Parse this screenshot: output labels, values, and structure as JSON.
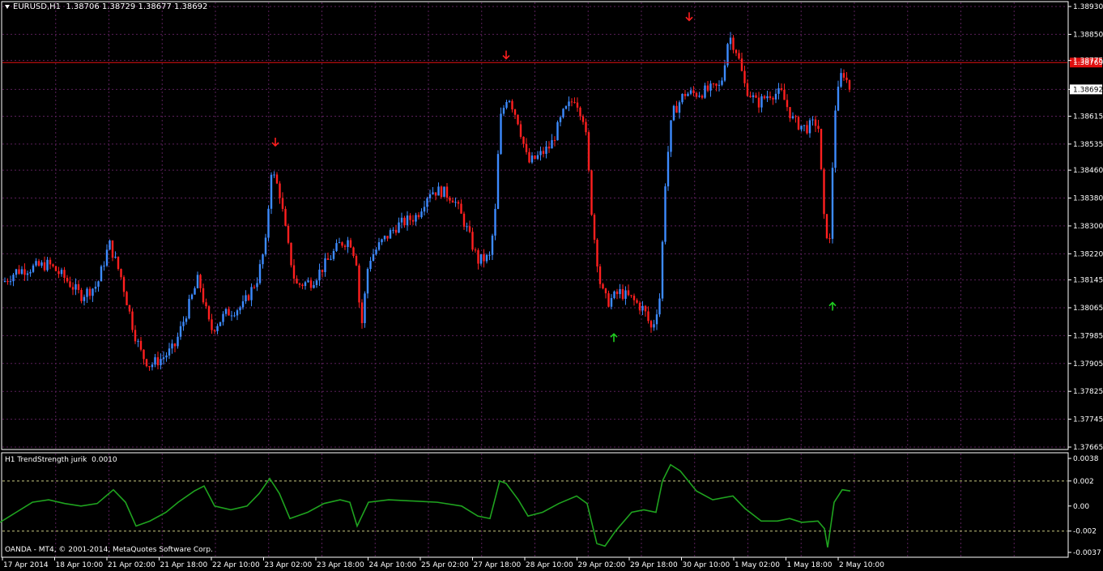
{
  "header": {
    "symbol": "EURUSD,H1",
    "open": "1.38706",
    "high": "1.38729",
    "low": "1.38677",
    "close": "1.38692"
  },
  "indicator": {
    "title": "H1 TrendStrength jurik",
    "value": "0.0010"
  },
  "copyright": "OANDA - MT4, © 2001-2014, MetaQuotes Software Corp.",
  "colors": {
    "background": "#000000",
    "bull": "#3d8bff",
    "bear": "#ff1f1f",
    "indicator": "#1fa31f",
    "grid": "#5a1f5a",
    "arrow_up": "#1fce1f",
    "arrow_down": "#ff1f1f"
  },
  "chart_data": {
    "type": "candlestick",
    "price_axis": [
      "1.38930",
      "1.38850",
      "1.38775",
      "1.38692",
      "1.38615",
      "1.38535",
      "1.38460",
      "1.38380",
      "1.38300",
      "1.38220",
      "1.38145",
      "1.38065",
      "1.37985",
      "1.37905",
      "1.37825",
      "1.37745",
      "1.37665"
    ],
    "ylim": [
      1.37665,
      1.3893
    ],
    "current_price": "1.38692",
    "bid_line_price": "1.38769",
    "time_axis": [
      "17 Apr 2014",
      "18 Apr 10:00",
      "21 Apr 02:00",
      "21 Apr 18:00",
      "22 Apr 10:00",
      "23 Apr 02:00",
      "23 Apr 18:00",
      "24 Apr 10:00",
      "25 Apr 02:00",
      "27 Apr 18:00",
      "28 Apr 10:00",
      "29 Apr 02:00",
      "29 Apr 18:00",
      "30 Apr 10:00",
      "1 May 02:00",
      "1 May 18:00",
      "2 May 10:00"
    ],
    "close_path": [
      [
        0,
        1.3813
      ],
      [
        20,
        1.3817
      ],
      [
        40,
        1.3818
      ],
      [
        60,
        1.3819
      ],
      [
        80,
        1.3815
      ],
      [
        100,
        1.381
      ],
      [
        120,
        1.3813
      ],
      [
        135,
        1.3825
      ],
      [
        150,
        1.3815
      ],
      [
        165,
        1.38
      ],
      [
        175,
        1.3793
      ],
      [
        185,
        1.379
      ],
      [
        200,
        1.3792
      ],
      [
        215,
        1.3795
      ],
      [
        230,
        1.3805
      ],
      [
        245,
        1.3815
      ],
      [
        260,
        1.38
      ],
      [
        280,
        1.3805
      ],
      [
        300,
        1.3807
      ],
      [
        318,
        1.3815
      ],
      [
        328,
        1.3825
      ],
      [
        335,
        1.3846
      ],
      [
        345,
        1.384
      ],
      [
        355,
        1.3825
      ],
      [
        365,
        1.3813
      ],
      [
        385,
        1.3814
      ],
      [
        405,
        1.382
      ],
      [
        420,
        1.3825
      ],
      [
        432,
        1.3826
      ],
      [
        440,
        1.382
      ],
      [
        446,
        1.38
      ],
      [
        455,
        1.382
      ],
      [
        470,
        1.3825
      ],
      [
        490,
        1.383
      ],
      [
        515,
        1.3833
      ],
      [
        530,
        1.384
      ],
      [
        545,
        1.384
      ],
      [
        560,
        1.3838
      ],
      [
        575,
        1.383
      ],
      [
        590,
        1.382
      ],
      [
        605,
        1.3821
      ],
      [
        612,
        1.3835
      ],
      [
        617,
        1.386
      ],
      [
        627,
        1.3868
      ],
      [
        640,
        1.386
      ],
      [
        652,
        1.3848
      ],
      [
        665,
        1.385
      ],
      [
        680,
        1.3853
      ],
      [
        695,
        1.3862
      ],
      [
        710,
        1.3867
      ],
      [
        722,
        1.386
      ],
      [
        732,
        1.383
      ],
      [
        742,
        1.3812
      ],
      [
        750,
        1.3808
      ],
      [
        765,
        1.3811
      ],
      [
        780,
        1.3809
      ],
      [
        795,
        1.3806
      ],
      [
        805,
        1.38
      ],
      [
        815,
        1.381
      ],
      [
        822,
        1.3845
      ],
      [
        830,
        1.3862
      ],
      [
        845,
        1.3868
      ],
      [
        860,
        1.3868
      ],
      [
        875,
        1.3869
      ],
      [
        890,
        1.387
      ],
      [
        900,
        1.3885
      ],
      [
        910,
        1.388
      ],
      [
        920,
        1.387
      ],
      [
        935,
        1.3865
      ],
      [
        950,
        1.3868
      ],
      [
        965,
        1.3868
      ],
      [
        980,
        1.386
      ],
      [
        995,
        1.3858
      ],
      [
        1010,
        1.386
      ],
      [
        1018,
        1.383
      ],
      [
        1025,
        1.3825
      ],
      [
        1030,
        1.3862
      ],
      [
        1040,
        1.3875
      ],
      [
        1050,
        1.3869
      ]
    ],
    "arrows": [
      {
        "dir": "down",
        "x": 340,
        "price": 1.3853
      },
      {
        "dir": "down",
        "x": 625,
        "price": 1.3878
      },
      {
        "dir": "down",
        "x": 851,
        "price": 1.3889
      },
      {
        "dir": "up",
        "x": 758,
        "price": 1.3799
      },
      {
        "dir": "up",
        "x": 1028,
        "price": 1.3808
      }
    ],
    "indicator_axis": [
      "0.0038",
      "0.002",
      "0.00",
      "-0.002",
      "-0.0037"
    ],
    "indicator_ylim": [
      -0.0037,
      0.0038
    ],
    "indicator_levels": [
      0.002,
      -0.002
    ],
    "indicator_series": [
      [
        0,
        -0.0013
      ],
      [
        20,
        -0.0005
      ],
      [
        40,
        0.0003
      ],
      [
        60,
        0.0005
      ],
      [
        80,
        0.0002
      ],
      [
        100,
        0.0
      ],
      [
        120,
        0.0002
      ],
      [
        140,
        0.0013
      ],
      [
        155,
        0.0003
      ],
      [
        168,
        -0.0016
      ],
      [
        185,
        -0.0012
      ],
      [
        205,
        -0.0005
      ],
      [
        220,
        0.0003
      ],
      [
        240,
        0.0012
      ],
      [
        252,
        0.0016
      ],
      [
        265,
        0.0
      ],
      [
        285,
        -0.0003
      ],
      [
        305,
        0.0
      ],
      [
        320,
        0.001
      ],
      [
        333,
        0.0022
      ],
      [
        345,
        0.001
      ],
      [
        358,
        -0.001
      ],
      [
        380,
        -0.0005
      ],
      [
        400,
        0.0002
      ],
      [
        420,
        0.0005
      ],
      [
        432,
        0.0003
      ],
      [
        441,
        -0.0016
      ],
      [
        455,
        0.0003
      ],
      [
        480,
        0.0005
      ],
      [
        510,
        0.0004
      ],
      [
        540,
        0.0003
      ],
      [
        570,
        0.0
      ],
      [
        590,
        -0.0008
      ],
      [
        605,
        -0.001
      ],
      [
        617,
        0.002
      ],
      [
        625,
        0.0018
      ],
      [
        640,
        0.0005
      ],
      [
        652,
        -0.0008
      ],
      [
        670,
        -0.0005
      ],
      [
        690,
        0.0002
      ],
      [
        712,
        0.0008
      ],
      [
        725,
        0.0002
      ],
      [
        737,
        -0.003
      ],
      [
        747,
        -0.0032
      ],
      [
        760,
        -0.002
      ],
      [
        780,
        -0.0005
      ],
      [
        795,
        -0.0003
      ],
      [
        810,
        -0.0005
      ],
      [
        818,
        0.002
      ],
      [
        828,
        0.0033
      ],
      [
        840,
        0.0028
      ],
      [
        860,
        0.0012
      ],
      [
        880,
        0.0005
      ],
      [
        905,
        0.0008
      ],
      [
        920,
        -0.0002
      ],
      [
        940,
        -0.0012
      ],
      [
        960,
        -0.0012
      ],
      [
        975,
        -0.001
      ],
      [
        990,
        -0.0013
      ],
      [
        1010,
        -0.0012
      ],
      [
        1018,
        -0.0018
      ],
      [
        1022,
        -0.0033
      ],
      [
        1030,
        0.0003
      ],
      [
        1040,
        0.0013
      ],
      [
        1050,
        0.0012
      ]
    ]
  }
}
